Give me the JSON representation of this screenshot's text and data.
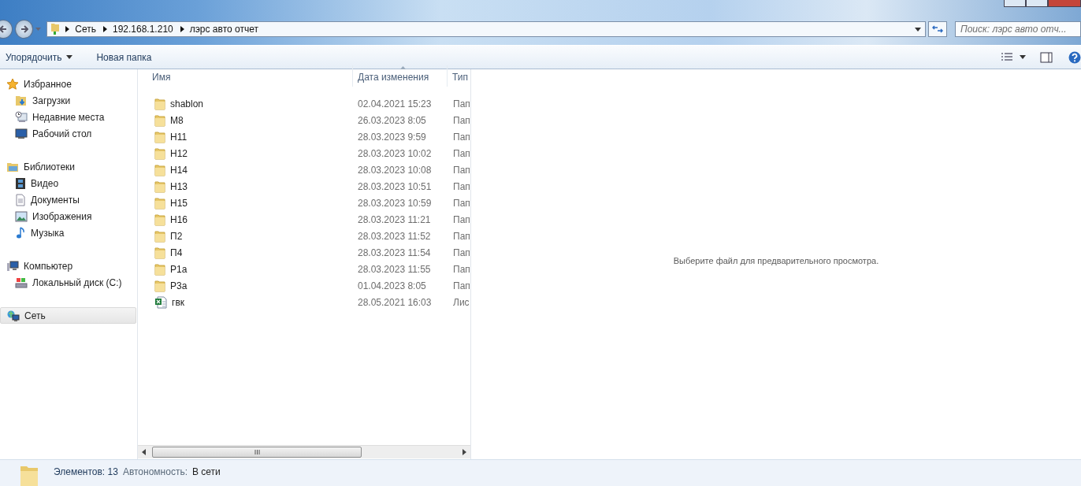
{
  "address_bar": {
    "crumbs": [
      "Сеть",
      "192.168.1.210",
      "лэрс авто отчет"
    ]
  },
  "search": {
    "placeholder": "Поиск: лэрс авто отч..."
  },
  "toolbar": {
    "buttons": [
      {
        "label": "Упорядочить",
        "dropdown": true
      },
      {
        "label": "Новая папка",
        "dropdown": false
      }
    ]
  },
  "sidebar": {
    "groups": [
      {
        "label": "Избранное",
        "kind": "star",
        "selected": false,
        "children": [
          {
            "label": "Загрузки",
            "kind": "downloads",
            "selected": false
          },
          {
            "label": "Недавние места",
            "kind": "recent",
            "selected": false
          },
          {
            "label": "Рабочий стол",
            "kind": "desktop",
            "selected": false
          }
        ]
      },
      {
        "label": "Библиотеки",
        "kind": "library",
        "selected": false,
        "children": [
          {
            "label": "Видео",
            "kind": "video",
            "selected": false
          },
          {
            "label": "Документы",
            "kind": "document",
            "selected": false
          },
          {
            "label": "Изображения",
            "kind": "picture",
            "selected": false
          },
          {
            "label": "Музыка",
            "kind": "music",
            "selected": false
          }
        ]
      },
      {
        "label": "Компьютер",
        "kind": "computer",
        "selected": false,
        "children": [
          {
            "label": "Локальный диск (C:)",
            "kind": "disk",
            "selected": false
          }
        ]
      },
      {
        "label": "Сеть",
        "kind": "network",
        "selected": true
      }
    ]
  },
  "file_list": {
    "columns": [
      {
        "label": "Имя",
        "sorted": false
      },
      {
        "label": "Дата изменения",
        "sorted": true
      },
      {
        "label": "Тип",
        "sorted": false
      }
    ],
    "rows": [
      {
        "name": "shablon",
        "date": "02.04.2021 15:23",
        "type": "Пап",
        "kind": "folder"
      },
      {
        "name": "M8",
        "date": "26.03.2023 8:05",
        "type": "Пап",
        "kind": "folder"
      },
      {
        "name": "H11",
        "date": "28.03.2023 9:59",
        "type": "Пап",
        "kind": "folder"
      },
      {
        "name": "H12",
        "date": "28.03.2023 10:02",
        "type": "Пап",
        "kind": "folder"
      },
      {
        "name": "H14",
        "date": "28.03.2023 10:08",
        "type": "Пап",
        "kind": "folder"
      },
      {
        "name": "H13",
        "date": "28.03.2023 10:51",
        "type": "Пап",
        "kind": "folder"
      },
      {
        "name": "H15",
        "date": "28.03.2023 10:59",
        "type": "Пап",
        "kind": "folder"
      },
      {
        "name": "H16",
        "date": "28.03.2023 11:21",
        "type": "Пап",
        "kind": "folder"
      },
      {
        "name": "П2",
        "date": "28.03.2023 11:52",
        "type": "Пап",
        "kind": "folder"
      },
      {
        "name": "П4",
        "date": "28.03.2023 11:54",
        "type": "Пап",
        "kind": "folder"
      },
      {
        "name": "P1a",
        "date": "28.03.2023 11:55",
        "type": "Пап",
        "kind": "folder"
      },
      {
        "name": "P3a",
        "date": "01.04.2023 8:05",
        "type": "Пап",
        "kind": "folder"
      },
      {
        "name": "гвк",
        "date": "28.05.2021 16:03",
        "type": "Лис",
        "kind": "spreadsheet"
      }
    ]
  },
  "preview": {
    "message": "Выберите файл для предварительного просмотра."
  },
  "status_bar": {
    "count": "Элементов: 13",
    "label": "Автономность:",
    "value": "В сети"
  }
}
